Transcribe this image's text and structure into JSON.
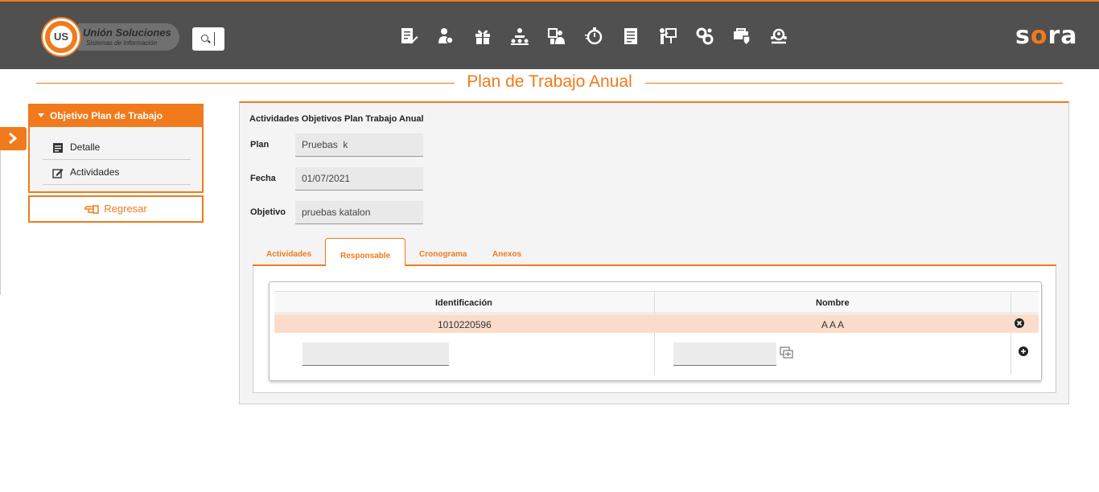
{
  "header": {
    "logo_mark": "US",
    "logo_title": "Unión Soluciones",
    "logo_subtitle": "Sistemas de Información",
    "brand_prefix": "s",
    "brand_o": "o",
    "brand_suffix": "ra",
    "nav_icons": [
      "document-edit-icon",
      "user-money-icon",
      "gift-icon",
      "hierarchy-icon",
      "person-chart-icon",
      "stopwatch-icon",
      "report-icon",
      "presentation-icon",
      "gears-icon",
      "truck-shield-icon",
      "search-people-icon"
    ]
  },
  "page": {
    "title": "Plan de Trabajo Anual"
  },
  "sidebar": {
    "header": "Objetivo Plan de Trabajo",
    "items": [
      {
        "label": "Detalle",
        "icon": "list-document-icon"
      },
      {
        "label": "Actividades",
        "icon": "edit-icon"
      }
    ],
    "back_label": "Regresar"
  },
  "main": {
    "section_title": "Actividades Objetivos Plan Trabajo Anual",
    "fields": [
      {
        "label": "Plan",
        "value": "Pruebas  k"
      },
      {
        "label": "Fecha",
        "value": "01/07/2021"
      },
      {
        "label": "Objetivo",
        "value": "pruebas katalon"
      }
    ],
    "tabs": [
      {
        "label": "Actividades",
        "active": false
      },
      {
        "label": "Responsable",
        "active": true
      },
      {
        "label": "Cronograma",
        "active": false
      },
      {
        "label": "Anexos",
        "active": false
      }
    ],
    "grid": {
      "columns": [
        "Identificación",
        "Nombre"
      ],
      "rows": [
        {
          "identificacion": "1010220596",
          "nombre": "A A A"
        }
      ],
      "new_row": {
        "identificacion": "",
        "nombre": ""
      }
    }
  },
  "colors": {
    "accent": "#f07a1c",
    "header_bg": "#505050",
    "row_highlight": "#fbdccb"
  }
}
